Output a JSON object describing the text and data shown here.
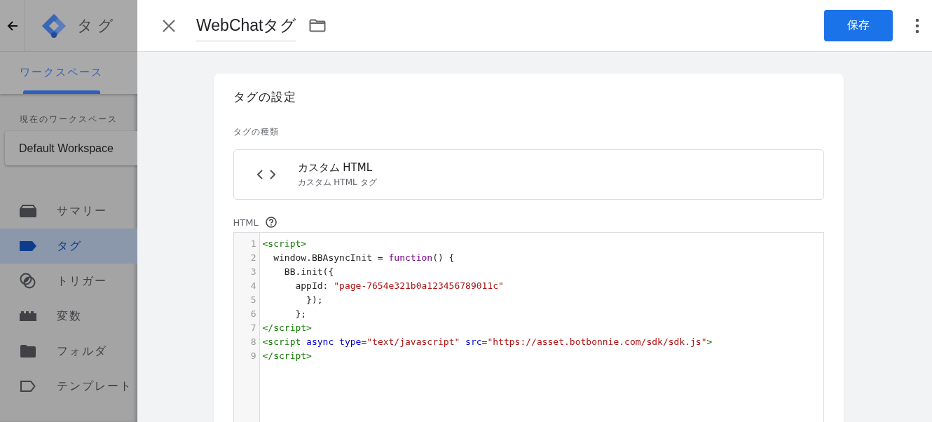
{
  "app": {
    "title": "タグ",
    "tab": "ワークスペース",
    "workspace_label": "現在のワークスペース",
    "workspace": "Default Workspace",
    "nav": [
      {
        "label": "サマリー",
        "selected": false
      },
      {
        "label": "タグ",
        "selected": true
      },
      {
        "label": "トリガー",
        "selected": false
      },
      {
        "label": "変数",
        "selected": false
      },
      {
        "label": "フォルダ",
        "selected": false
      },
      {
        "label": "テンプレート",
        "selected": false
      }
    ]
  },
  "panel": {
    "name": "WebChatタグ",
    "save": "保存",
    "card": {
      "title": "タグの設定",
      "type_label": "タグの種類",
      "type_name": "カスタム HTML",
      "type_sub": "カスタム HTML タグ",
      "html_label": "HTML",
      "code": [
        {
          "number": "1",
          "tokens": [
            {
              "kind": "tag",
              "text": "<script>"
            }
          ]
        },
        {
          "number": "2",
          "tokens": [
            {
              "kind": "plain",
              "text": "  window.BBAsyncInit = "
            },
            {
              "kind": "keyword",
              "text": "function"
            },
            {
              "kind": "plain",
              "text": "() {"
            }
          ]
        },
        {
          "number": "3",
          "tokens": [
            {
              "kind": "plain",
              "text": "    BB.init({"
            }
          ]
        },
        {
          "number": "4",
          "tokens": [
            {
              "kind": "plain",
              "text": "      appId: "
            },
            {
              "kind": "string",
              "text": "\"page-7654e321b0a123456789011c\""
            }
          ]
        },
        {
          "number": "5",
          "tokens": [
            {
              "kind": "plain",
              "text": "        });"
            }
          ]
        },
        {
          "number": "6",
          "tokens": [
            {
              "kind": "plain",
              "text": "      };"
            }
          ]
        },
        {
          "number": "7",
          "tokens": [
            {
              "kind": "tag",
              "text": "</script>"
            }
          ]
        },
        {
          "number": "8",
          "tokens": [
            {
              "kind": "tag",
              "text": "<script"
            },
            {
              "kind": "attr",
              "text": " async"
            },
            {
              "kind": "attr",
              "text": " type"
            },
            {
              "kind": "plain",
              "text": "="
            },
            {
              "kind": "string",
              "text": "\"text/javascript\""
            },
            {
              "kind": "attr",
              "text": " src"
            },
            {
              "kind": "plain",
              "text": "="
            },
            {
              "kind": "string",
              "text": "\"https://asset.botbonnie.com/sdk/sdk.js\""
            },
            {
              "kind": "tag",
              "text": ">"
            }
          ]
        },
        {
          "number": "9",
          "tokens": [
            {
              "kind": "tag",
              "text": "</script>"
            }
          ]
        }
      ]
    }
  }
}
